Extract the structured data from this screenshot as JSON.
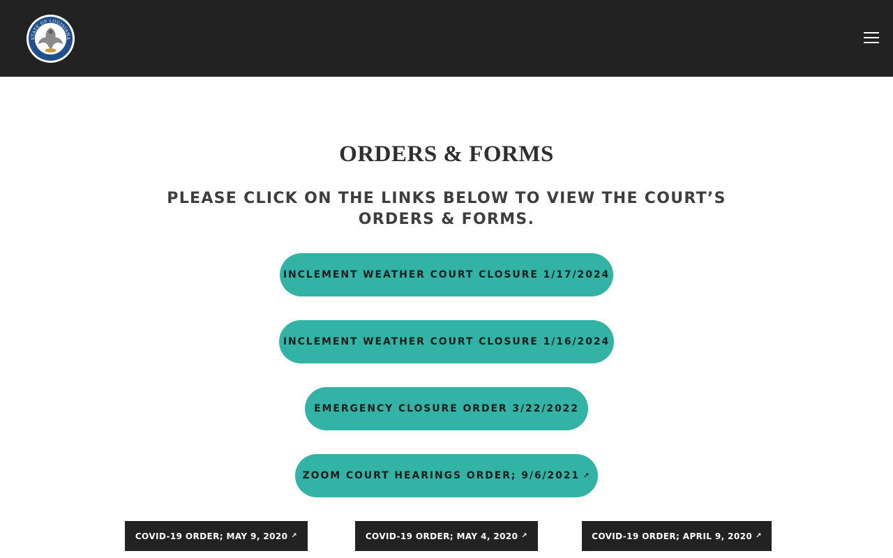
{
  "header": {
    "logo_alt": "State of Louisiana seal",
    "logo_text": "STATE OF LOUISIANA",
    "menu_icon": "hamburger-menu-icon"
  },
  "main": {
    "title": "ORDERS & FORMS",
    "subtitle": "PLEASE CLICK ON THE LINKS BELOW TO VIEW THE COURT’S ORDERS & FORMS.",
    "pill_links": [
      {
        "label": "INCLEMENT WEATHER COURT CLOSURE 1/17/2024",
        "external": false
      },
      {
        "label": "INCLEMENT WEATHER COURT CLOSURE 1/16/2024",
        "external": false
      },
      {
        "label": "EMERGENCY CLOSURE ORDER 3/22/2022",
        "external": false
      },
      {
        "label": "ZOOM COURT HEARINGS ORDER; 9/6/2021",
        "external": true
      }
    ],
    "box_links": [
      {
        "label": "COVID-19 ORDER; MAY 9, 2020",
        "external": true
      },
      {
        "label": "COVID-19 ORDER; MAY 4, 2020",
        "external": true
      },
      {
        "label": "COVID-19 ORDER; APRIL 9, 2020",
        "external": true
      }
    ],
    "external_glyph": "↗"
  },
  "colors": {
    "header_bg": "#222222",
    "pill_bg": "#33b3a6",
    "box_bg": "#222222",
    "text": "#3b3b3b"
  }
}
